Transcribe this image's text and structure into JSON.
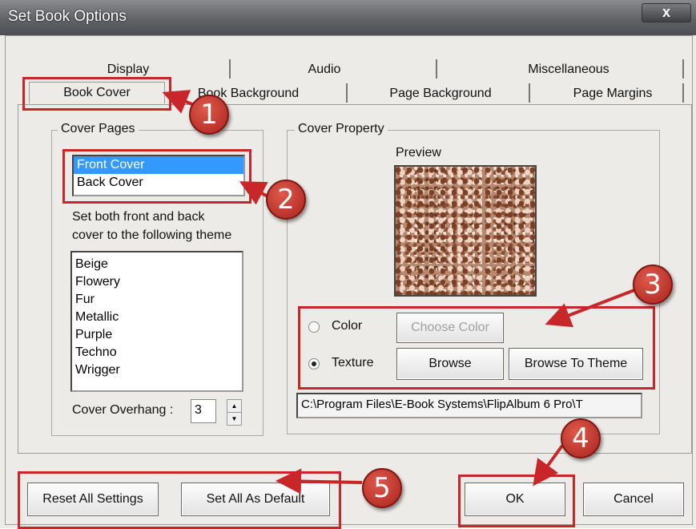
{
  "window": {
    "title": "Set Book Options",
    "close_label": "x"
  },
  "tabs": {
    "row_back": [
      "Display",
      "Audio",
      "Miscellaneous"
    ],
    "row_front": [
      "Book Cover",
      "Book Background",
      "Page Background",
      "Page Margins"
    ]
  },
  "cover_pages": {
    "group_label": "Cover Pages",
    "items": [
      "Front Cover",
      "Back Cover"
    ],
    "selected": "Front Cover",
    "theme_instruction": [
      "Set both front and back",
      "cover to the following theme"
    ],
    "themes": [
      "Beige",
      "Flowery",
      "Fur",
      "Metallic",
      "Purple",
      "Techno",
      "Wrigger"
    ],
    "overhang_label": "Cover Overhang :",
    "overhang_value": "3"
  },
  "cover_property": {
    "group_label": "Cover Property",
    "preview_label": "Preview",
    "color_label": "Color",
    "choose_color_label": "Choose Color",
    "texture_label": "Texture",
    "browse_label": "Browse",
    "browse_theme_label": "Browse To Theme",
    "path": "C:\\Program Files\\E-Book Systems\\FlipAlbum 6 Pro\\T",
    "selected_option": "Texture"
  },
  "footer": {
    "reset_label": "Reset All Settings",
    "default_label": "Set All As Default",
    "ok_label": "OK",
    "cancel_label": "Cancel"
  },
  "callouts": [
    "1",
    "2",
    "3",
    "4",
    "5"
  ],
  "colors": {
    "callout_red": "#c9262a",
    "selection_blue": "#3399ff"
  }
}
